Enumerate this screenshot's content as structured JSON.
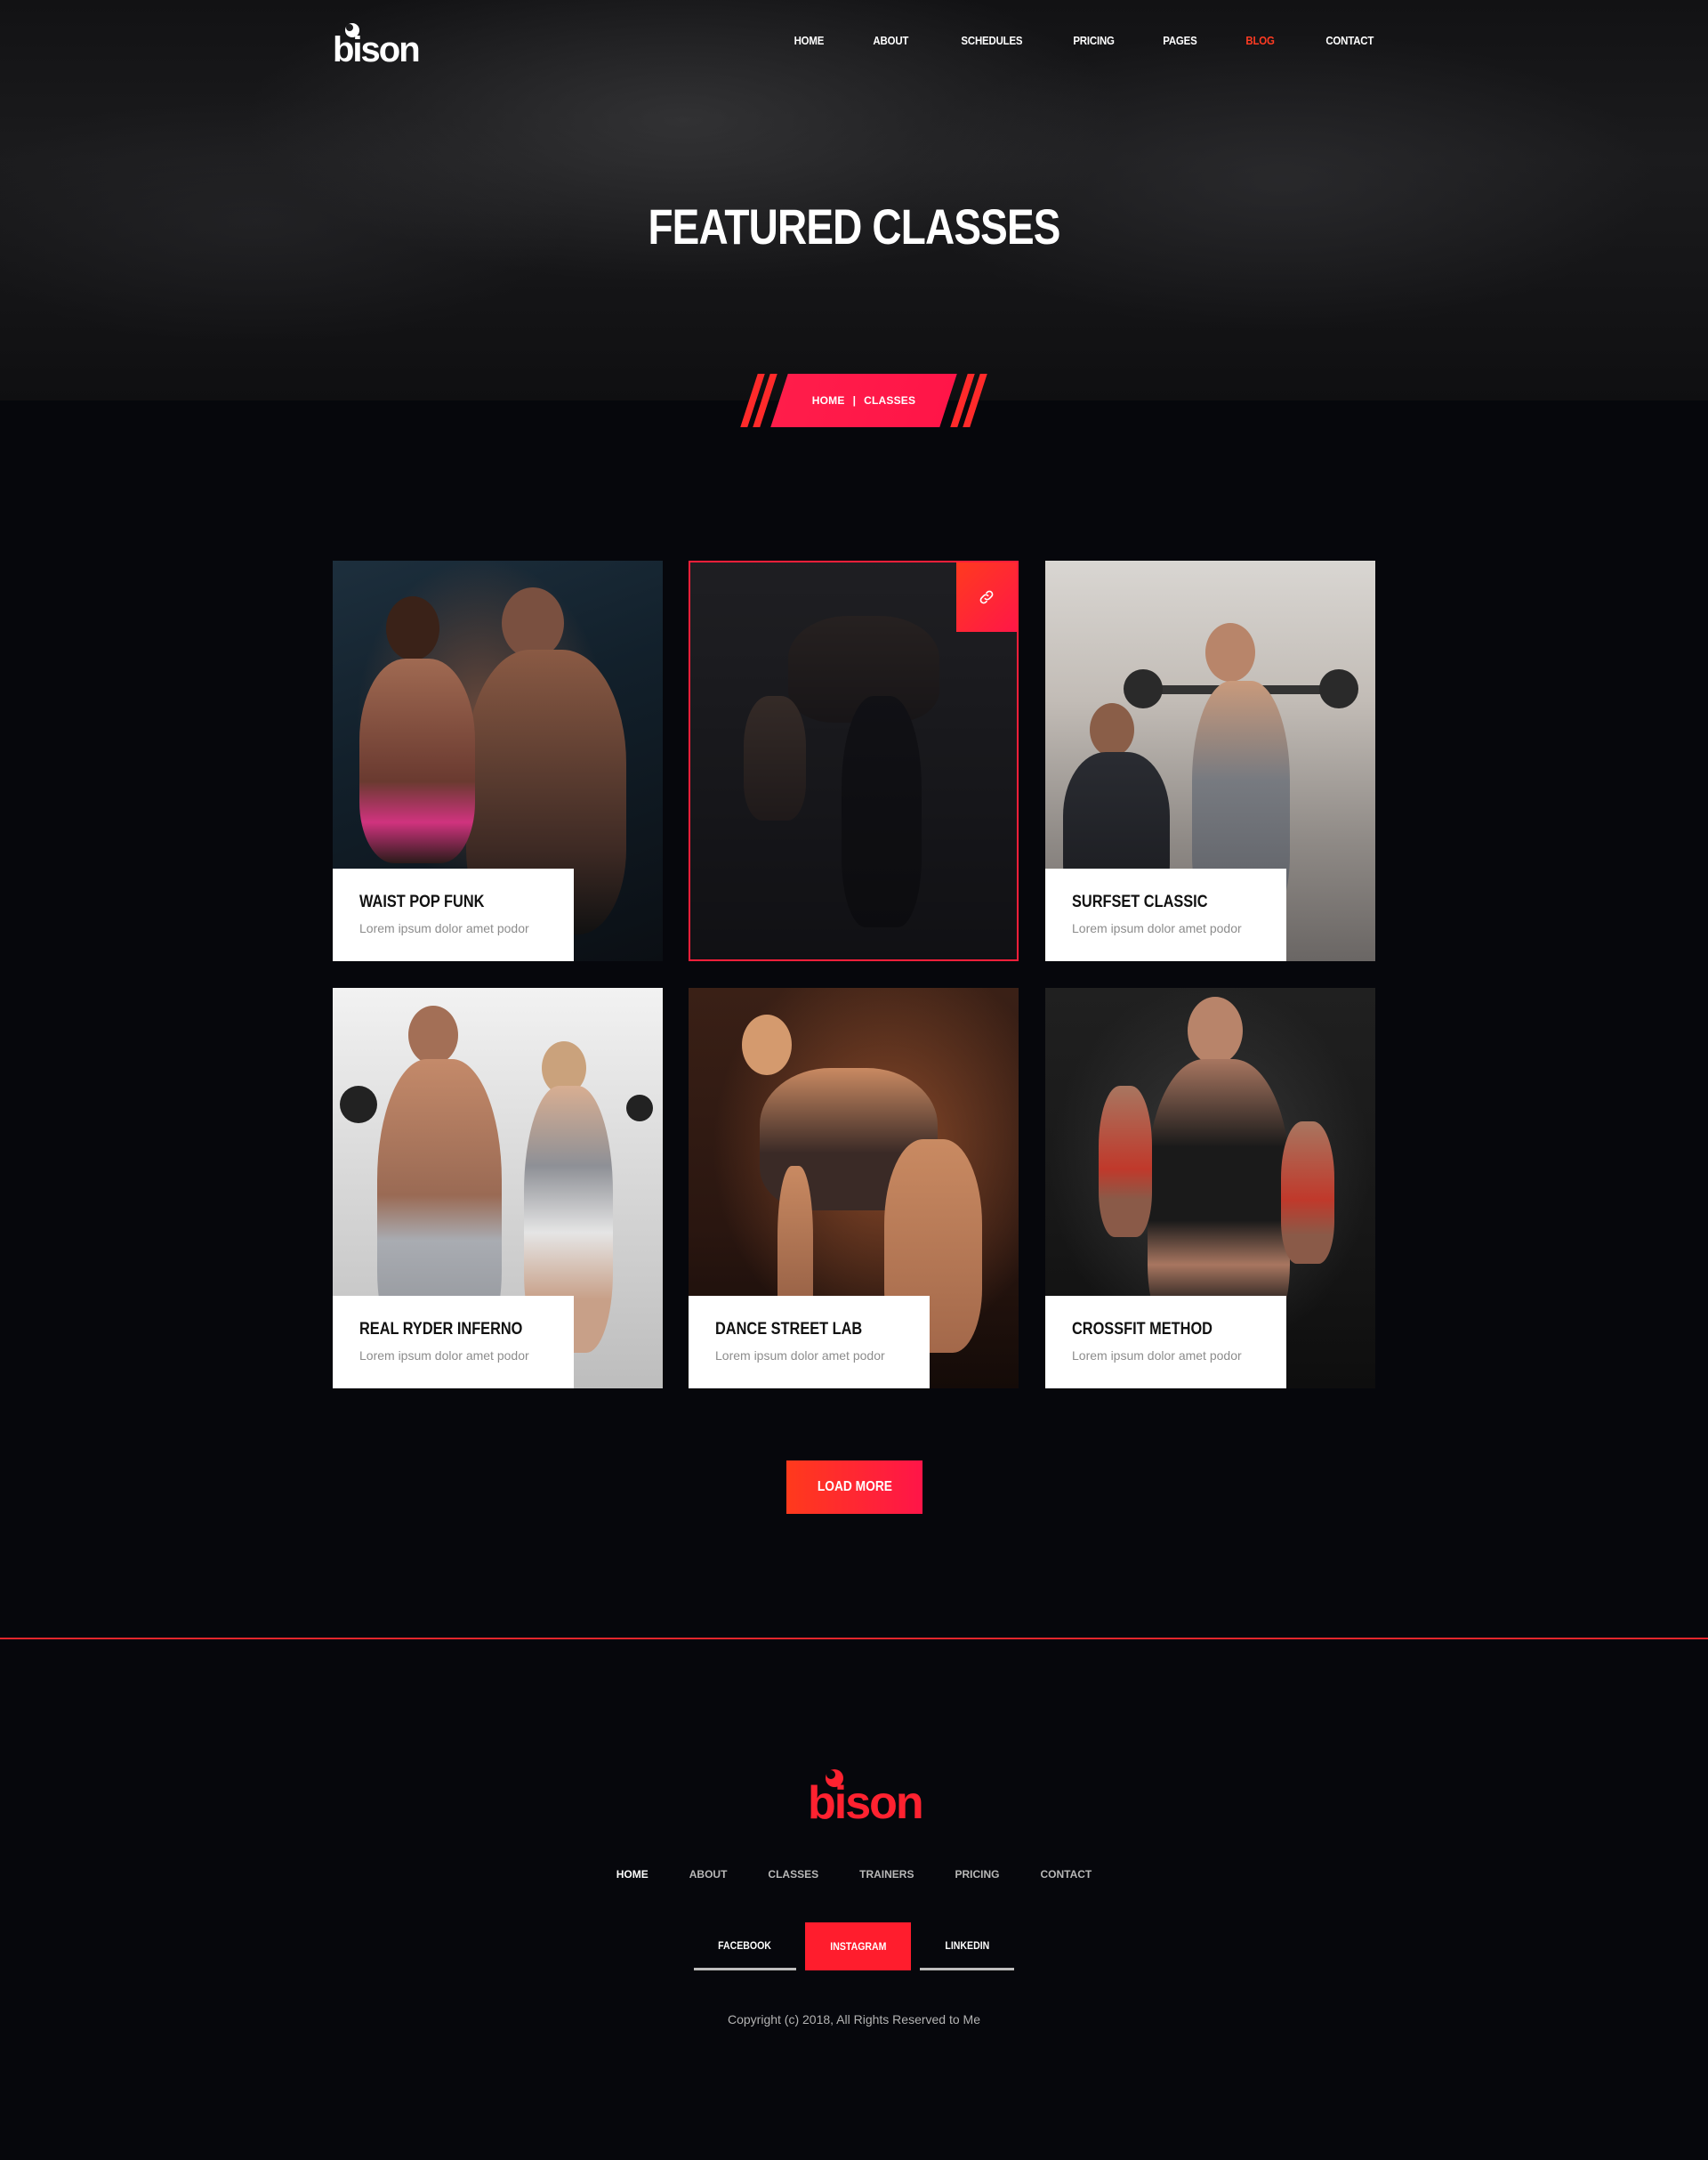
{
  "header": {
    "logo_text": "bison",
    "nav": [
      {
        "label": "HOME"
      },
      {
        "label": "ABOUT"
      },
      {
        "label": "SCHEDULES"
      },
      {
        "label": "PRICING"
      },
      {
        "label": "PAGES"
      },
      {
        "label": "BLOG"
      },
      {
        "label": "CONTACT"
      }
    ],
    "active_nav": "BLOG",
    "active_color": "#ff3b22"
  },
  "hero": {
    "title": "FEATURED CLASSES"
  },
  "breadcrumb": {
    "home": "HOME",
    "separator": "|",
    "current": "CLASSES"
  },
  "classes": [
    {
      "title": "WAIST POP FUNK",
      "description": "Lorem ipsum dolor amet podor"
    },
    {
      "title": "",
      "description": "",
      "link_icon": "link-icon"
    },
    {
      "title": "SURFSET CLASSIC",
      "description": "Lorem ipsum dolor amet podor"
    },
    {
      "title": "REAL RYDER INFERNO",
      "description": "Lorem ipsum dolor amet podor"
    },
    {
      "title": "DANCE STREET LAB",
      "description": "Lorem ipsum dolor amet podor"
    },
    {
      "title": "CROSSFIT METHOD",
      "description": "Lorem ipsum dolor amet podor"
    }
  ],
  "load_more": "LOAD MORE",
  "footer": {
    "logo_text": "bison",
    "nav": [
      {
        "label": "HOME"
      },
      {
        "label": "ABOUT"
      },
      {
        "label": "CLASSES"
      },
      {
        "label": "TRAINERS"
      },
      {
        "label": "PRICING"
      },
      {
        "label": "CONTACT"
      }
    ],
    "social": {
      "facebook": "FACEBOOK",
      "instagram": "INSTAGRAM",
      "linkedin": "LINKEDIN"
    },
    "copyright": "Copyright (c) 2018, All Rights Reserved to Me"
  },
  "colors": {
    "accent": "#ff1d4a",
    "background": "#06070c",
    "footer_line": "#e3262c"
  }
}
